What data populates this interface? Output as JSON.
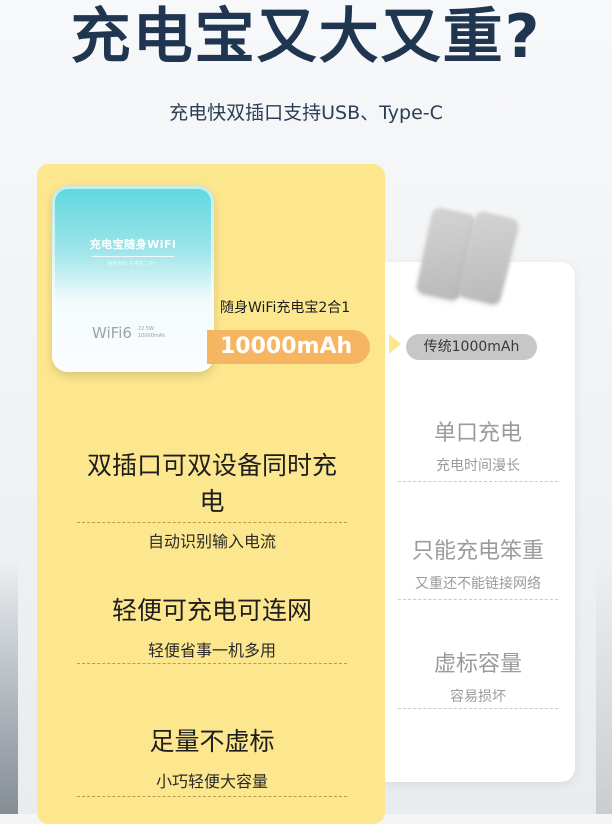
{
  "headline": "充电宝又大又重?",
  "subline": "充电快双插口支持USB、Type-C",
  "device": {
    "brand": "充电宝随身WiFi",
    "small_text": "随身WiFi 充电宝二合一",
    "wifi_logo": "WiFi6",
    "spec_line1": "22.5W",
    "spec_line2": "10000mAh"
  },
  "product_tag": "随身WiFi充电宝2合1",
  "capacity": "10000mAh",
  "traditional_label": "传统1000mAh",
  "features": [
    {
      "title": "双插口可双设备同时充电",
      "sub": "自动识别输入电流"
    },
    {
      "title": "轻便可充电可连网",
      "sub": "轻便省事一机多用"
    },
    {
      "title": "足量不虚标",
      "sub": "小巧轻便大容量"
    }
  ],
  "drawbacks": [
    {
      "title": "单口充电",
      "sub": "充电时间漫长"
    },
    {
      "title": "只能充电笨重",
      "sub": "又重还不能链接网络"
    },
    {
      "title": "虚标容量",
      "sub": "容易损坏"
    }
  ],
  "colors": {
    "headline": "#1f3550",
    "card_yellow": "#fde78e",
    "capacity_pill": "#f6b661",
    "traditional_pill": "#c7c7c7",
    "device_teal": "#5fd7df"
  }
}
